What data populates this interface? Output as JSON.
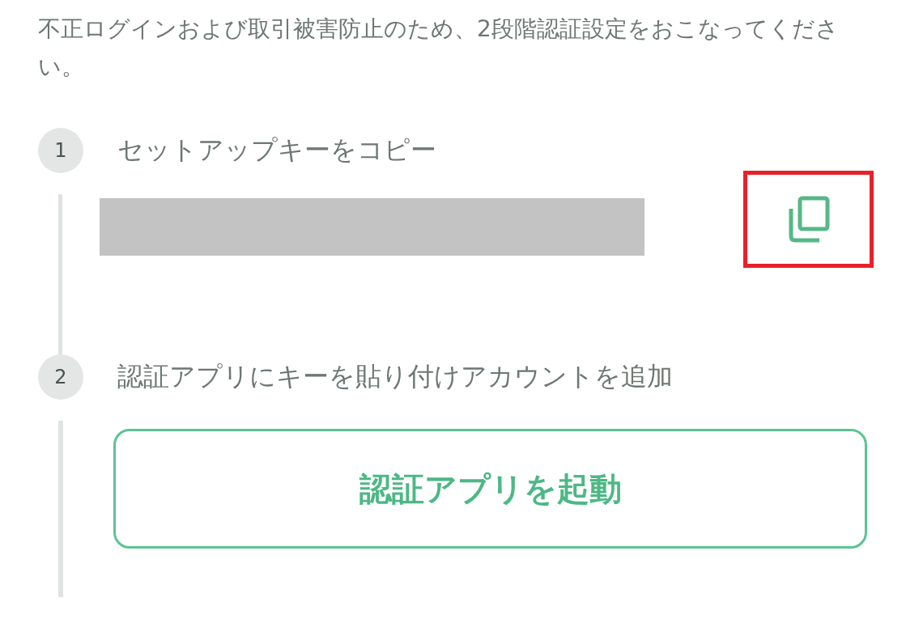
{
  "intro": "不正ログインおよび取引被害防止のため、2段階認証設定をおこなってください。",
  "steps": [
    {
      "number": "1",
      "title": "セットアップキーをコピー",
      "kind": "copy",
      "highlighted": true
    },
    {
      "number": "2",
      "title": "認証アプリにキーを貼り付けアカウントを追加",
      "kind": "button",
      "button": "認証アプリを起動"
    }
  ]
}
